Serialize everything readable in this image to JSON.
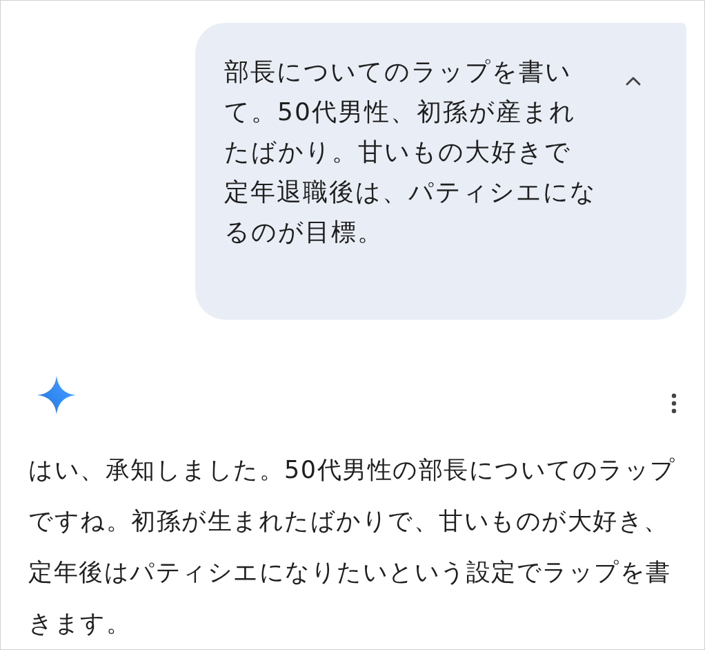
{
  "prompt": {
    "text": "部長についてのラップを書いて。50代男性、初孫が産まれたばかり。甘いもの大好きで定年退職後は、パティシエになるのが目標。",
    "expanded": true
  },
  "response": {
    "text": "はい、承知しました。50代男性の部長についてのラップですね。初孫が生まれたばかりで、甘いものが大好き、定年後はパティシエになりたいという設定でラップを書きます。"
  }
}
